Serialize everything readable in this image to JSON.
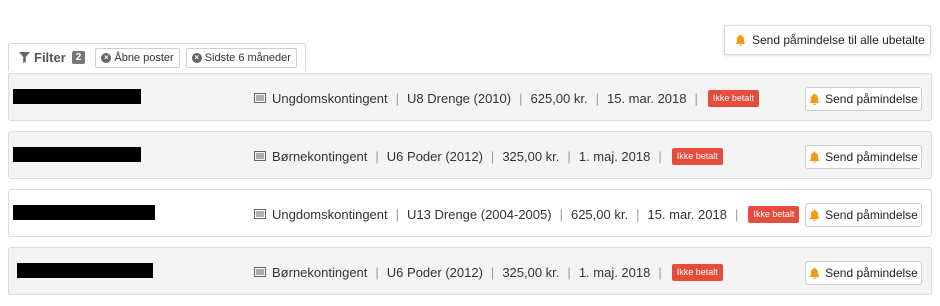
{
  "toolbar": {
    "send_all_label": "Send påmindelse til alle ubetalte"
  },
  "filter": {
    "label": "Filter",
    "count": "2",
    "chips": [
      {
        "label": "Åbne poster"
      },
      {
        "label": "Sidste 6 måneder"
      }
    ]
  },
  "rows": [
    {
      "fee_type": "Ungdomskontingent",
      "team": "U8 Drenge (2010)",
      "amount": "625,00 kr.",
      "date": "15. mar. 2018",
      "status": "Ikke betalt",
      "button": "Send påmindelse"
    },
    {
      "fee_type": "Børnekontingent",
      "team": "U6 Poder (2012)",
      "amount": "325,00 kr.",
      "date": "1. maj. 2018",
      "status": "Ikke betalt",
      "button": "Send påmindelse"
    },
    {
      "fee_type": "Ungdomskontingent",
      "team": "U13 Drenge (2004-2005)",
      "amount": "625,00 kr.",
      "date": "15. mar. 2018",
      "status": "Ikke betalt",
      "button": "Send påmindelse"
    },
    {
      "fee_type": "Børnekontingent",
      "team": "U6 Poder (2012)",
      "amount": "325,00 kr.",
      "date": "1. maj. 2018",
      "status": "Ikke betalt",
      "button": "Send påmindelse"
    }
  ],
  "colors": {
    "status_badge": "#e64c3c",
    "bell": "#f39c12",
    "row_alt": "#f4f4f4"
  },
  "icons": {
    "bell": "bell-icon",
    "document": "document-icon",
    "filter": "filter-icon",
    "remove": "remove-circle-icon"
  }
}
